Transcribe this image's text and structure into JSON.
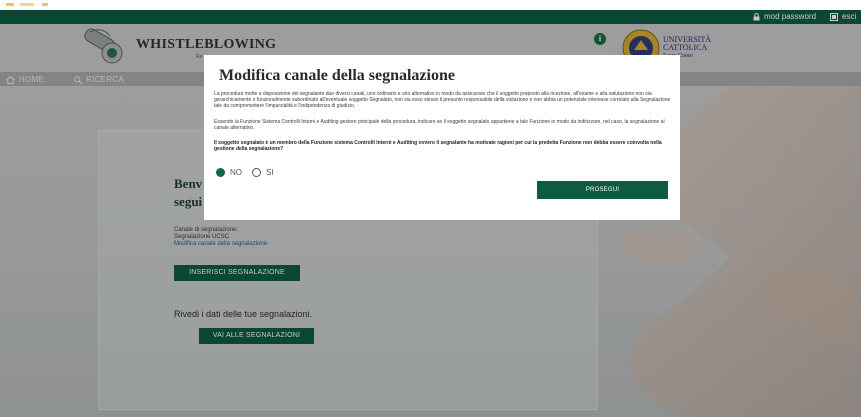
{
  "topbar": {
    "mod_password": "mod password",
    "esci": "esci"
  },
  "header": {
    "logo_text": "WHISTLEBLOWING",
    "logo_subtext": "Re",
    "university_lines": [
      "UNIVERSITÀ",
      "CATTOLICA",
      "Sacro Cuore"
    ]
  },
  "nav": {
    "home": "HOME",
    "ricerca": "RICERCA"
  },
  "page": {
    "welcome_line1": "Benv",
    "welcome_line2": "segui",
    "channel_label": "Canale di segnalazione:",
    "channel_value": "Segnalazione UCSC",
    "channel_link": "Modifica canale della segnalazione",
    "inserisci_button": "INSERISCI SEGNALAZIONE",
    "rivedi_text": "Rivedi i dati delle tue segnalazioni.",
    "vai_button": "VAI ALLE SEGNALAZIONI"
  },
  "modal": {
    "title": "Modifica canale della segnalazione",
    "paragraph1": "La procedura mette a disposizione del segnalante due diversi canali, uno ordinario e uno alternativo in modo da assicurare che il soggetto preposto alla ricezione, all'esame e alla valutazione non sia gerarchicamente o funzionalmente subordinato all'eventuale soggetto Segnalato, non sia esso stesso il presunto responsabile della violazione e non abbia un potenziale interesse correlato alla Segnalazione tale da compromettere l'imparzialità e l'indipendenza di giudizio.",
    "paragraph2": "Essendo la Funzione Sistema Controlli Interni e Auditing gestore principale della procedura, indicare se il soggetto segnalato appartiene a tale Funzione in modo da indirizzare, nel caso, la segnalazione al canale alternativo.",
    "question": "Il soggetto segnalato è un membro della Funzione sistema Controlli Interni e Auditing ovvero il segnalante ha motivate ragioni per cui la predetta Funzione non debba essere coinvolta nella gestione della segnalazione?",
    "option_no": "NO",
    "option_si": "SI",
    "selected": "NO",
    "prosegui_button": "PROSEGUI"
  },
  "colors": {
    "brand_green": "#0d5b43",
    "overlay": "rgba(0,0,0,0.22)"
  }
}
